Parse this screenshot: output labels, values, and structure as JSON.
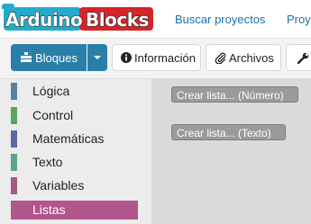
{
  "navbar": {
    "logo_text_a": "Arduino",
    "logo_text_b": "Blocks",
    "links": [
      "Buscar proyectos",
      "Proy"
    ]
  },
  "toolbar": {
    "blocks_label": "Bloques",
    "info_label": "Información",
    "files_label": "Archivos"
  },
  "categories": [
    {
      "label": "Lógica",
      "color": "#5b80a5"
    },
    {
      "label": "Control",
      "color": "#5ba55b"
    },
    {
      "label": "Matemáticas",
      "color": "#5b67a5"
    },
    {
      "label": "Texto",
      "color": "#5ba58c"
    },
    {
      "label": "Variables",
      "color": "#a55b80"
    },
    {
      "label": "Listas",
      "color": "#b1558d",
      "selected": true
    }
  ],
  "flyout": {
    "blocks": [
      "Crear lista... (Número)",
      "Crear lista... (Texto)"
    ]
  },
  "colors": {
    "primary": "#2a7fa8",
    "link": "#1f6fa7",
    "logo_blue": "#27a9c9",
    "logo_red": "#d4252a"
  }
}
